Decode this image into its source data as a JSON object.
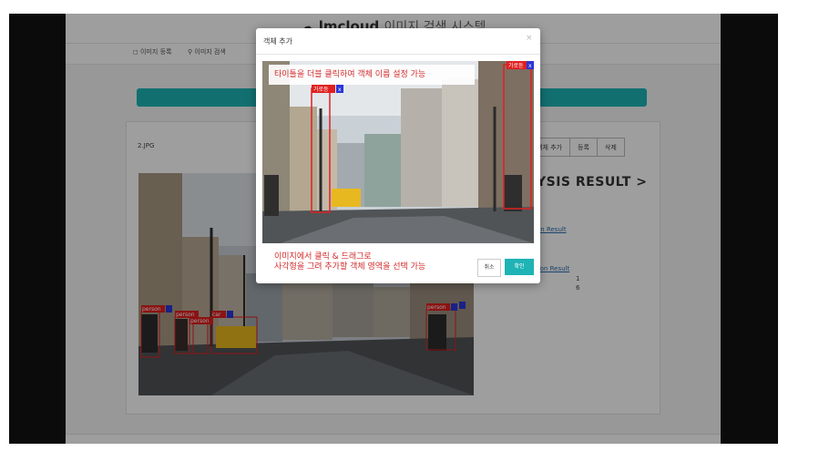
{
  "app": {
    "title_main": "lmcloud",
    "title_sub": "이미지 검색 시스템",
    "nav": [
      {
        "label": "이미지 등록",
        "icon": "upload-icon"
      },
      {
        "label": "이미지 검색",
        "icon": "search-icon"
      }
    ]
  },
  "content": {
    "file_name": "2.JPG",
    "buttons": [
      "객체 추가",
      "등록",
      "삭제"
    ],
    "result_title": "YSIS RESULT >",
    "links": [
      "on Result",
      "son Result"
    ],
    "counts": [
      "1",
      "6"
    ],
    "detections": [
      {
        "label": "person"
      },
      {
        "label": "person"
      },
      {
        "label": "car"
      },
      {
        "label": "person"
      },
      {
        "label": "person"
      }
    ]
  },
  "modal": {
    "title": "객체 추가",
    "close": "×",
    "hint_top": "타이틀을 더블 클릭하여 객체 이름 설정 가능",
    "hint_bottom_line1": "이미지에서 클릭 & 드래그로",
    "hint_bottom_line2": "사각형을 그려 추가할 객체 영역을 선택 가능",
    "cancel_label": "취소",
    "ok_label": "확인",
    "boxes": [
      {
        "label": "가로등",
        "delete": "x"
      },
      {
        "label": "가로등",
        "delete": "x"
      }
    ]
  },
  "colors": {
    "accent": "#1eb3b5",
    "hint_text": "#d32b2b",
    "box": "#e02020",
    "delete_tag": "#2b36d8"
  }
}
